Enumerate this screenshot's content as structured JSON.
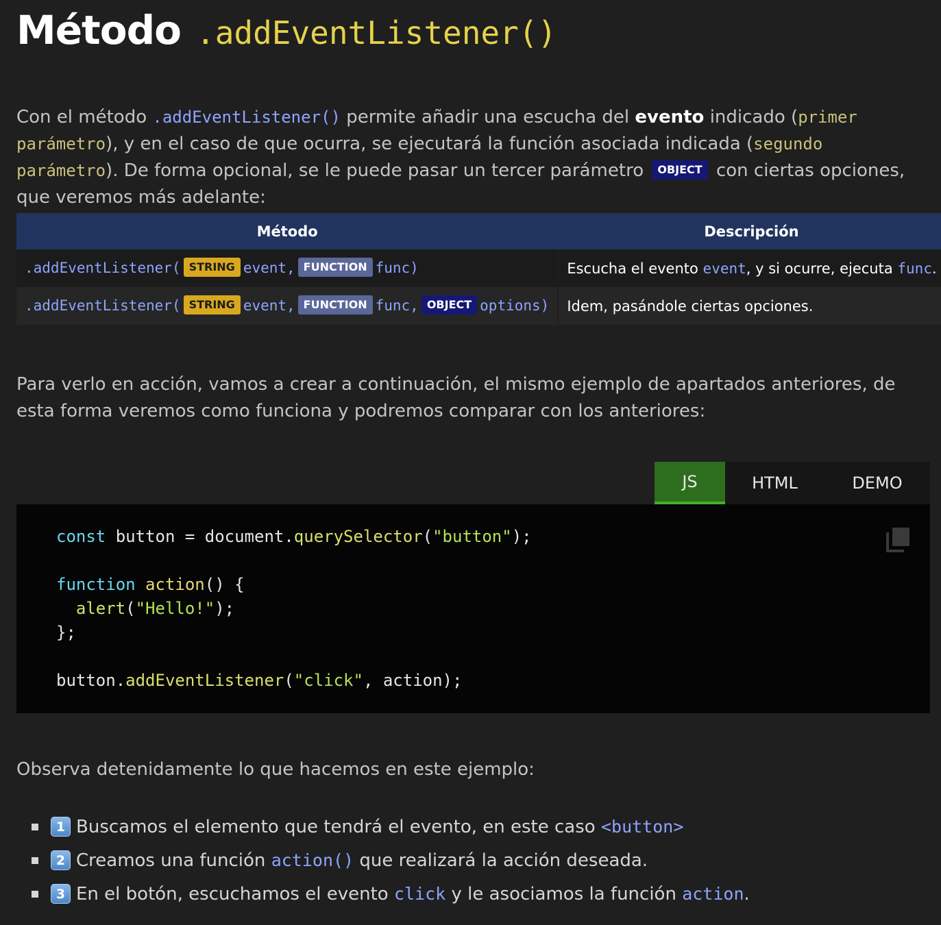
{
  "title": {
    "word": "Método",
    "code": ".addEventListener()"
  },
  "intro": {
    "t1": "Con el método ",
    "c1": ".addEventListener()",
    "t2": " permite añadir una escucha del ",
    "b1": "evento",
    "t3": " indicado (",
    "c2": "primer parámetro",
    "t4": "), y en el caso de que ocurra, se ejecutará la función asociada indicada (",
    "c3": "segundo parámetro",
    "t5": "). De forma opcional, se le puede pasar un tercer parámetro ",
    "badge": "OBJECT",
    "t6": " con ciertas opciones, que veremos más adelante:"
  },
  "table": {
    "headers": [
      "Método",
      "Descripción"
    ],
    "rows": [
      {
        "m_prefix": ".addEventListener(",
        "b1": "STRING",
        "p1": "event,",
        "b2": "FUNCTION",
        "p2": "func)",
        "d1": "Escucha el evento ",
        "dc1": "event",
        "d2": ", y si ocurre, ejecuta ",
        "dc2": "func",
        "d3": "."
      },
      {
        "m_prefix": ".addEventListener(",
        "b1": "STRING",
        "p1": "event,",
        "b2": "FUNCTION",
        "p2": "func,",
        "b3": "OBJECT",
        "p3": "options)",
        "d1": "Idem, pasándole ciertas opciones."
      }
    ]
  },
  "para2": "Para verlo en acción, vamos a crear a continuación, el mismo ejemplo de apartados anteriores, de esta forma veremos como funciona y podremos comparar con los anteriores:",
  "tabs": [
    "JS",
    "HTML",
    "DEMO"
  ],
  "code": {
    "l1": {
      "kw": "const",
      "a": " button = document.",
      "fn": "querySelector",
      "b": "(",
      "s": "\"button\"",
      "c": ");"
    },
    "l3": {
      "kw": "function",
      "a": " ",
      "fn": "action",
      "b": "() {"
    },
    "l4": {
      "indent": "  ",
      "fn": "alert",
      "b": "(",
      "s": "\"Hello!\"",
      "c": ");"
    },
    "l5": "};",
    "l7": {
      "a": "button.",
      "fn": "addEventListener",
      "b": "(",
      "s": "\"click\"",
      "c": ", action);"
    }
  },
  "para3": "Observa detenidamente lo que hacemos en este ejemplo:",
  "steps": [
    {
      "num": "1",
      "text": "Buscamos el elemento que tendrá el evento, en este caso ",
      "code": "<button>",
      "tail": ""
    },
    {
      "num": "2",
      "text": "Creamos una función ",
      "code": "action()",
      "tail": " que realizará la acción deseada."
    },
    {
      "num": "3",
      "text": "En el botón, escuchamos el evento ",
      "code": "click",
      "tail": " y le asociamos la función ",
      "code2": "action",
      "tail2": "."
    }
  ],
  "icons": {
    "copy": "copy-icon"
  },
  "colors": {
    "background": "#1f1f1f",
    "table_header": "#21345f",
    "tab_active": "#2d6e1e",
    "accent_yellow": "#e5d24a"
  }
}
